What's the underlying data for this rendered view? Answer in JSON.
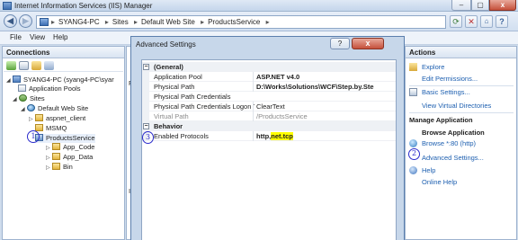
{
  "window": {
    "title": "Internet Information Services (IIS) Manager"
  },
  "address": {
    "crumbs": [
      "SYANG4-PC",
      "Sites",
      "Default Web Site",
      "ProductsService"
    ],
    "separator": "▸"
  },
  "menu": {
    "file": "File",
    "view": "View",
    "help": "Help"
  },
  "connections": {
    "header": "Connections",
    "tree": {
      "server": "SYANG4-PC (syang4-PC\\syar",
      "app_pools": "Application Pools",
      "sites": "Sites",
      "default_site": "Default Web Site",
      "aspnet_client": "aspnet_client",
      "msmq": "MSMQ",
      "products_service": "ProductsService",
      "app_code": "App_Code",
      "app_data": "App_Data",
      "bin": "Bin"
    }
  },
  "center": {
    "partial_fi": "Fi",
    "partial_ip": "IP"
  },
  "dialog": {
    "title": "Advanced Settings",
    "help_label": "?",
    "close_label": "x",
    "general": {
      "category": "(General)",
      "rows": [
        {
          "name": "Application Pool",
          "value": "ASP.NET v4.0",
          "bold": true
        },
        {
          "name": "Physical Path",
          "value": "D:\\Works\\Solutions\\WCF\\Step.by.Ste",
          "bold": true
        },
        {
          "name": "Physical Path Credentials",
          "value": ""
        },
        {
          "name": "Physical Path Credentials Logon T",
          "value": "ClearText"
        },
        {
          "name": "Virtual Path",
          "value": "/ProductsService",
          "muted": true
        }
      ]
    },
    "behavior": {
      "category": "Behavior",
      "protocols_name": "Enabled Protocols",
      "protocols_value_plain": "http,",
      "protocols_value_highlight": "net.tcp"
    }
  },
  "actions": {
    "header": "Actions",
    "explore": "Explore",
    "edit_permissions": "Edit Permissions...",
    "basic_settings": "Basic Settings...",
    "view_virtual_dirs": "View Virtual Directories",
    "manage_app": "Manage Application",
    "browse_app": "Browse Application",
    "browse_80": "Browse *:80 (http)",
    "advanced_settings": "Advanced Settings...",
    "help": "Help",
    "online_help": "Online Help"
  },
  "annotations": {
    "one": "1",
    "two": "2",
    "three": "3"
  },
  "colors": {
    "link": "#1d5fb0",
    "highlight": "#ffff00",
    "annotation": "#2b2bcc"
  }
}
